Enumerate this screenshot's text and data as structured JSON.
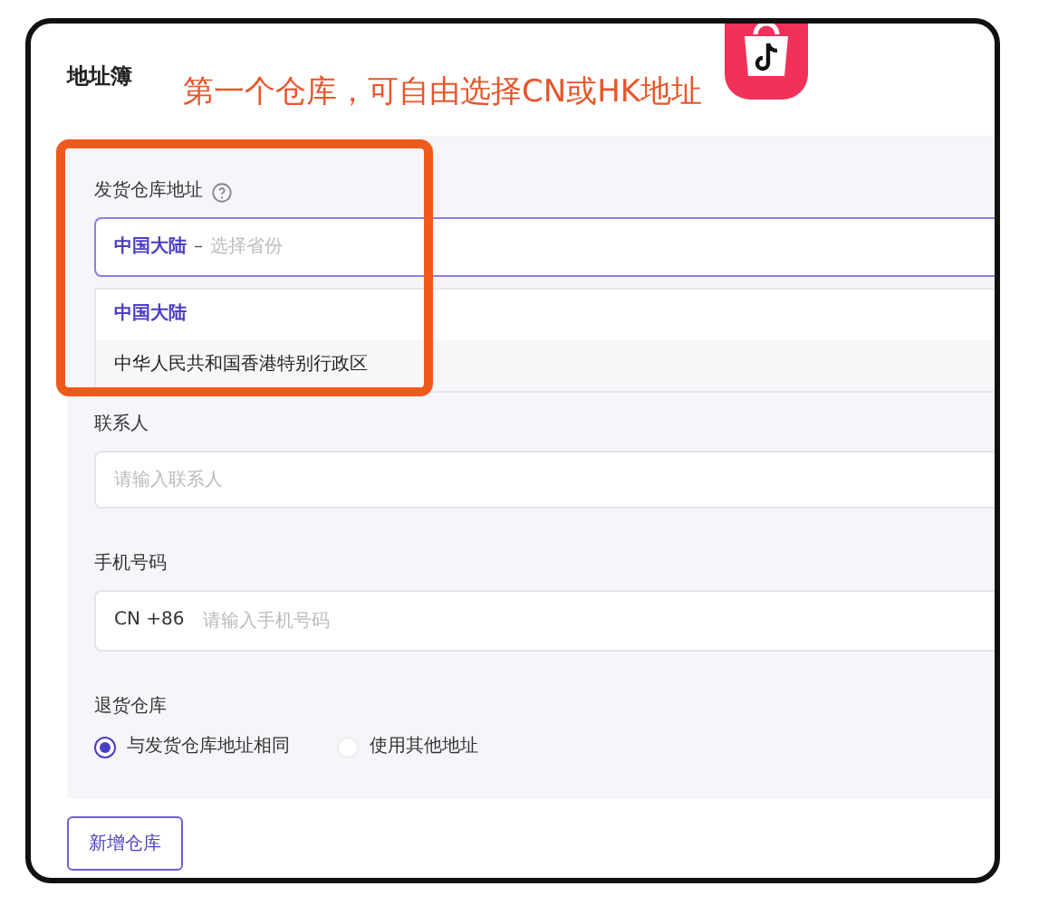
{
  "title": "地址簿",
  "annotation": {
    "text": "第一个仓库，可自由选择CN或HK地址"
  },
  "warehouse": {
    "label": "发货仓库地址",
    "select": {
      "value": "中国大陆",
      "separator": "–",
      "placeholder": "选择省份"
    },
    "options": [
      {
        "label": "中国大陆",
        "selected": true
      },
      {
        "label": "中华人民共和国香港特别行政区",
        "selected": false
      }
    ]
  },
  "contact": {
    "label": "联系人",
    "placeholder": "请输入联系人"
  },
  "phone": {
    "label": "手机号码",
    "prefix": "CN +86",
    "placeholder": "请输入手机号码"
  },
  "return_warehouse": {
    "label": "退货仓库",
    "options": [
      {
        "label": "与发货仓库地址相同",
        "selected": true
      },
      {
        "label": "使用其他地址",
        "selected": false
      }
    ]
  },
  "add_button": "新增仓库"
}
